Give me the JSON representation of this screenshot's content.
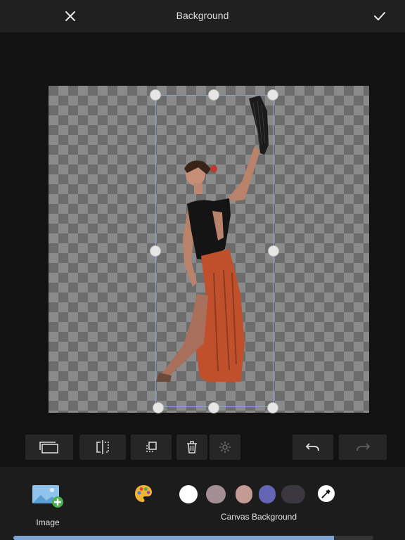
{
  "header": {
    "title": "Background",
    "close_icon": "close-icon",
    "confirm_icon": "check-icon"
  },
  "toolbar": {
    "left_tools": [
      "aspect-ratio-icon",
      "flip-horizontal-icon",
      "duplicate-icon",
      "delete-icon",
      "settings-icon"
    ],
    "settings_disabled": true,
    "undo_icon": "undo-icon",
    "redo_icon": "redo-icon",
    "redo_disabled": true
  },
  "bottom": {
    "image_label": "Image",
    "palette_icon": "palette-icon",
    "swatches": [
      {
        "name": "white",
        "color": "#ffffff"
      },
      {
        "name": "mauve-gray",
        "color": "#a38f93"
      },
      {
        "name": "dusty-rose",
        "color": "#c39b92"
      },
      {
        "name": "periwinkle",
        "color": "#6565b6"
      },
      {
        "name": "charcoal",
        "color": "#3a383e"
      }
    ],
    "eyedropper_icon": "eyedropper-icon",
    "canvas_background_label": "Canvas Background"
  },
  "progress": {
    "value": 0.89,
    "color": "#7fa4d6"
  },
  "colors": {
    "topbar": "#202020",
    "background": "#121212",
    "panel": "#1c1c1c",
    "selection": "#8aa0d8"
  }
}
